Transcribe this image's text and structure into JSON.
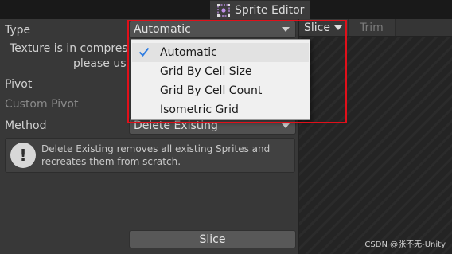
{
  "window": {
    "tab_title": "Sprite Editor"
  },
  "toolbar": {
    "slice_label": "Slice",
    "trim_label": "Trim"
  },
  "panel": {
    "type_label": "Type",
    "type_value": "Automatic",
    "texture_note_line1": "Texture is in compres",
    "texture_note_line2": "please us",
    "pivot_label": "Pivot",
    "custom_pivot_label": "Custom Pivot",
    "method_label": "Method",
    "method_value": "Delete Existing",
    "help_text": "Delete Existing removes all existing Sprites and recreates them from scratch.",
    "slice_button_label": "Slice"
  },
  "type_dropdown": {
    "selected": "Automatic",
    "options": [
      "Automatic",
      "Grid By Cell Size",
      "Grid By Cell Count",
      "Isometric Grid"
    ]
  },
  "watermark": "CSDN @张不无-Unity",
  "colors": {
    "highlight": "#e0101a",
    "panel_bg": "#383838",
    "check_mark": "#2f7de1"
  },
  "icons": {
    "tab": "sprite-editor-icon",
    "check": "check-icon",
    "help": "exclamation-icon",
    "dropdown": "chevron-down-icon"
  }
}
